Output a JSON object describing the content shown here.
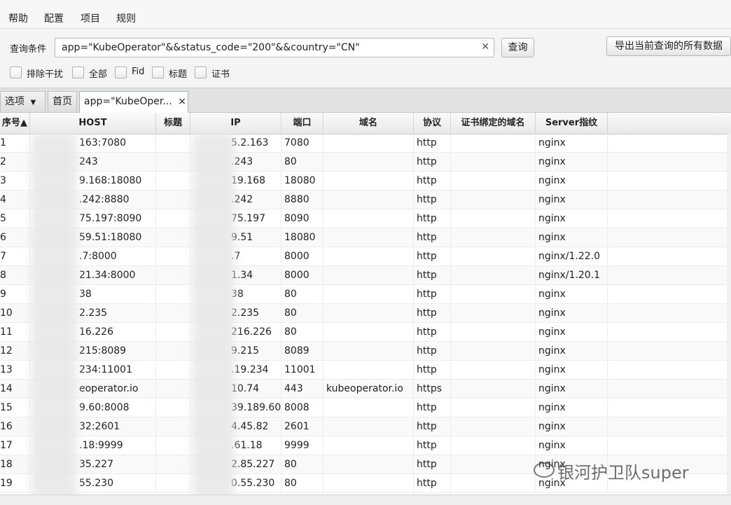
{
  "menu": [
    "帮助",
    "配置",
    "项目",
    "规则"
  ],
  "query": {
    "label": "查询条件",
    "value": "app=\"KubeOperator\"&&status_code=\"200\"&&country=\"CN\"",
    "clear_icon": "✕",
    "search_label": "查询",
    "export_label": "导出当前查询的所有数据"
  },
  "filters": [
    "排除干扰",
    "全部",
    "Fid",
    "标题",
    "证书"
  ],
  "tabs": {
    "options_label": "选项",
    "home_label": "首页",
    "query_tab_label": "app=\"KubeOper...",
    "close_icon": "×"
  },
  "table": {
    "columns": [
      "序号▲",
      "HOST",
      "标题",
      "IP",
      "端口",
      "域名",
      "协议",
      "证书绑定的域名",
      "Server指纹"
    ],
    "rows": [
      [
        "1",
        "163:7080",
        "",
        "5.2.163",
        "7080",
        "",
        "http",
        "",
        "nginx"
      ],
      [
        "2",
        "243",
        "",
        ".243",
        "80",
        "",
        "http",
        "",
        "nginx"
      ],
      [
        "3",
        "9.168:18080",
        "",
        "19.168",
        "18080",
        "",
        "http",
        "",
        "nginx"
      ],
      [
        "4",
        ".242:8880",
        "",
        ".242",
        "8880",
        "",
        "http",
        "",
        "nginx"
      ],
      [
        "5",
        "75.197:8090",
        "",
        "75.197",
        "8090",
        "",
        "http",
        "",
        "nginx"
      ],
      [
        "6",
        "59.51:18080",
        "",
        "9.51",
        "18080",
        "",
        "http",
        "",
        "nginx"
      ],
      [
        "7",
        ".7:8000",
        "",
        ".7",
        "8000",
        "",
        "http",
        "",
        "nginx/1.22.0"
      ],
      [
        "8",
        "21.34:8000",
        "",
        "1.34",
        "8000",
        "",
        "http",
        "",
        "nginx/1.20.1"
      ],
      [
        "9",
        "38",
        "",
        "38",
        "80",
        "",
        "http",
        "",
        "nginx"
      ],
      [
        "10",
        "2.235",
        "",
        "2.235",
        "80",
        "",
        "http",
        "",
        "nginx"
      ],
      [
        "11",
        "16.226",
        "",
        "216.226",
        "80",
        "",
        "http",
        "",
        "nginx"
      ],
      [
        "12",
        "215:8089",
        "",
        "9.215",
        "8089",
        "",
        "http",
        "",
        "nginx"
      ],
      [
        "13",
        "234:11001",
        "",
        ".19.234",
        "11001",
        "",
        "http",
        "",
        "nginx"
      ],
      [
        "14",
        "eoperator.io",
        "",
        "10.74",
        "443",
        "kubeoperator.io",
        "https",
        "",
        "nginx"
      ],
      [
        "15",
        "9.60:8008",
        "",
        "39.189.60",
        "8008",
        "",
        "http",
        "",
        "nginx"
      ],
      [
        "16",
        "32:2601",
        "",
        "4.45.82",
        "2601",
        "",
        "http",
        "",
        "nginx"
      ],
      [
        "17",
        ".18:9999",
        "",
        ".61.18",
        "9999",
        "",
        "http",
        "",
        "nginx"
      ],
      [
        "18",
        "35.227",
        "",
        "2.85.227",
        "80",
        "",
        "http",
        "",
        "nginx"
      ],
      [
        "19",
        "55.230",
        "",
        "0.55.230",
        "80",
        "",
        "http",
        "",
        "nginx"
      ]
    ]
  },
  "watermark": "银河护卫队super"
}
